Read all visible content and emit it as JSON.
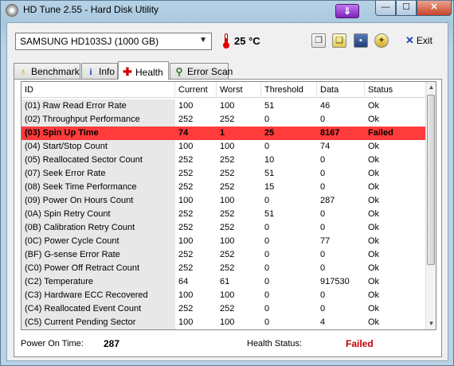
{
  "window": {
    "title": "HD Tune 2.55 - Hard Disk Utility",
    "menu_arrow": "⇓",
    "minimize": "—",
    "maximize": "☐",
    "close": "✕"
  },
  "toolbar": {
    "drive": "SAMSUNG HD103SJ (1000 GB)",
    "temperature": "25 °C",
    "exit_label": "Exit"
  },
  "tabs": [
    {
      "label": "Benchmark",
      "icon": "stopwatch-icon"
    },
    {
      "label": "Info",
      "icon": "info-icon"
    },
    {
      "label": "Health",
      "icon": "health-cross-icon",
      "active": true
    },
    {
      "label": "Error Scan",
      "icon": "magnifier-icon"
    }
  ],
  "table": {
    "headers": [
      "ID",
      "Current",
      "Worst",
      "Threshold",
      "Data",
      "Status"
    ],
    "rows": [
      [
        "(01) Raw Read Error Rate",
        "100",
        "100",
        "51",
        "46",
        "Ok"
      ],
      [
        "(02) Throughput Performance",
        "252",
        "252",
        "0",
        "0",
        "Ok"
      ],
      [
        "(03) Spin Up Time",
        "74",
        "1",
        "25",
        "8167",
        "Failed"
      ],
      [
        "(04) Start/Stop Count",
        "100",
        "100",
        "0",
        "74",
        "Ok"
      ],
      [
        "(05) Reallocated Sector Count",
        "252",
        "252",
        "10",
        "0",
        "Ok"
      ],
      [
        "(07) Seek Error Rate",
        "252",
        "252",
        "51",
        "0",
        "Ok"
      ],
      [
        "(08) Seek Time Performance",
        "252",
        "252",
        "15",
        "0",
        "Ok"
      ],
      [
        "(09) Power On Hours Count",
        "100",
        "100",
        "0",
        "287",
        "Ok"
      ],
      [
        "(0A) Spin Retry Count",
        "252",
        "252",
        "51",
        "0",
        "Ok"
      ],
      [
        "(0B) Calibration Retry Count",
        "252",
        "252",
        "0",
        "0",
        "Ok"
      ],
      [
        "(0C) Power Cycle Count",
        "100",
        "100",
        "0",
        "77",
        "Ok"
      ],
      [
        "(BF) G-sense Error Rate",
        "252",
        "252",
        "0",
        "0",
        "Ok"
      ],
      [
        "(C0) Power Off Retract Count",
        "252",
        "252",
        "0",
        "0",
        "Ok"
      ],
      [
        "(C2) Temperature",
        "64",
        "61",
        "0",
        "917530",
        "Ok"
      ],
      [
        "(C3) Hardware ECC Recovered",
        "100",
        "100",
        "0",
        "0",
        "Ok"
      ],
      [
        "(C4) Reallocated Event Count",
        "252",
        "252",
        "0",
        "0",
        "Ok"
      ],
      [
        "(C5) Current Pending Sector",
        "100",
        "100",
        "0",
        "4",
        "Ok"
      ]
    ],
    "failed_row_color": "#ff3b3b"
  },
  "status": {
    "power_on_label": "Power On Time:",
    "power_on_value": "287",
    "health_label": "Health Status:",
    "health_value": "Failed",
    "health_color": "#c00000"
  }
}
